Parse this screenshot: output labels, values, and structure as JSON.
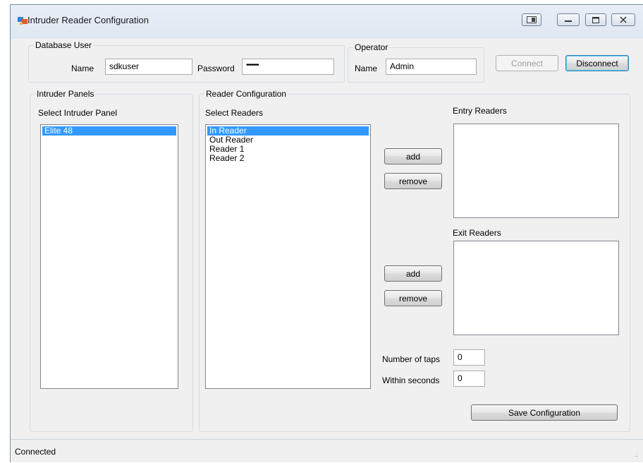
{
  "window": {
    "title": "Intruder Reader Configuration",
    "title_buttons": [
      "restore-app-icon",
      "minimize-icon",
      "maximize-icon",
      "close-icon"
    ]
  },
  "database_user": {
    "group_label": "Database User",
    "name_label": "Name",
    "name_value": "sdkuser",
    "password_label": "Password",
    "password_value": "•••••••"
  },
  "operator": {
    "group_label": "Operator",
    "name_label": "Name",
    "name_value": "Admin"
  },
  "buttons": {
    "connect": "Connect",
    "disconnect": "Disconnect",
    "entry_add": "add",
    "entry_remove": "remove",
    "exit_add": "add",
    "exit_remove": "remove",
    "save": "Save Configuration"
  },
  "intruder_panels": {
    "group_label": "Intruder Panels",
    "select_label": "Select Intruder Panel",
    "items": [
      {
        "label": "Elite 48",
        "selected": true
      }
    ]
  },
  "reader_configuration": {
    "group_label": "Reader Configuration",
    "select_label": "Select Readers",
    "items": [
      {
        "label": "In Reader",
        "selected": true
      },
      {
        "label": "Out Reader",
        "selected": false
      },
      {
        "label": "Reader 1",
        "selected": false
      },
      {
        "label": "Reader 2",
        "selected": false
      }
    ],
    "entry_label": "Entry Readers",
    "exit_label": "Exit Readers",
    "taps_label": "Number of taps",
    "taps_value": "0",
    "seconds_label": "Within seconds",
    "seconds_value": "0"
  },
  "status": {
    "text": "Connected"
  },
  "colors": {
    "selection": "#3399ff",
    "window_bg": "#f0f0f0",
    "titlebar": "#dfe7f1"
  }
}
